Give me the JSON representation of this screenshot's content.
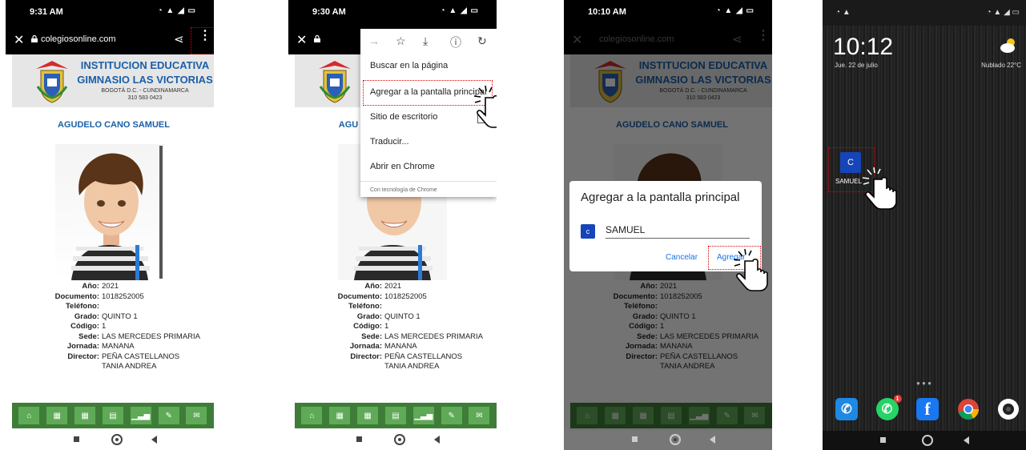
{
  "steps": [
    {
      "status_time": "9:31 AM",
      "url": "colegiosonline.com"
    },
    {
      "status_time": "9:30 AM"
    },
    {
      "status_time": "10:10 AM"
    }
  ],
  "school": {
    "line1": "INSTITUCION EDUCATIVA",
    "line2": "GIMNASIO LAS VICTORIAS",
    "line3": "BOGOTÁ D.C. - CUNDINAMARCA",
    "line4": "310 583 0423"
  },
  "student": {
    "name": "AGUDELO CANO SAMUEL",
    "fields": [
      {
        "label": "Año:",
        "value": "2021"
      },
      {
        "label": "Documento:",
        "value": "1018252005"
      },
      {
        "label": "Teléfono:",
        "value": ""
      },
      {
        "label": "Grado:",
        "value": "QUINTO 1"
      },
      {
        "label": "Código:",
        "value": "1"
      },
      {
        "label": "Sede:",
        "value": "LAS MERCEDES PRIMARIA"
      },
      {
        "label": "Jornada:",
        "value": "MANANA"
      },
      {
        "label": "Director:",
        "value": "PEÑA CASTELLANOS"
      },
      {
        "label": "",
        "value": "TANIA ANDREA"
      }
    ]
  },
  "chrome_menu": {
    "items": [
      "Buscar en la página",
      "Agregar a la pantalla principal",
      "Sitio de escritorio",
      "Traducir...",
      "Abrir en Chrome"
    ],
    "footer": "Con tecnología de Chrome"
  },
  "dialog": {
    "title": "Agregar a la pantalla principal",
    "icon_letter": "c",
    "name_value": "SAMUEL",
    "cancel": "Cancelar",
    "add": "Agregar"
  },
  "home": {
    "clock": "10:12",
    "date": "Jue. 22 de julio",
    "weather": "Nublado  22°C",
    "shortcut_letter": "C",
    "shortcut_label": "SAMUEL"
  },
  "colors": {
    "school_blue": "#1a5fa8",
    "tab_green": "#3e7d38",
    "tap_marker": "#e00000",
    "shortcut_blue": "#1545b8"
  },
  "icons": [
    "close-icon",
    "lock-icon",
    "share-icon",
    "more-vert-icon",
    "forward-icon",
    "star-icon",
    "download-icon",
    "info-icon",
    "refresh-icon",
    "home-icon",
    "grid-icon",
    "apps-icon",
    "document-icon",
    "chart-icon",
    "pencil-icon",
    "mail-icon",
    "tap-hand-icon"
  ]
}
